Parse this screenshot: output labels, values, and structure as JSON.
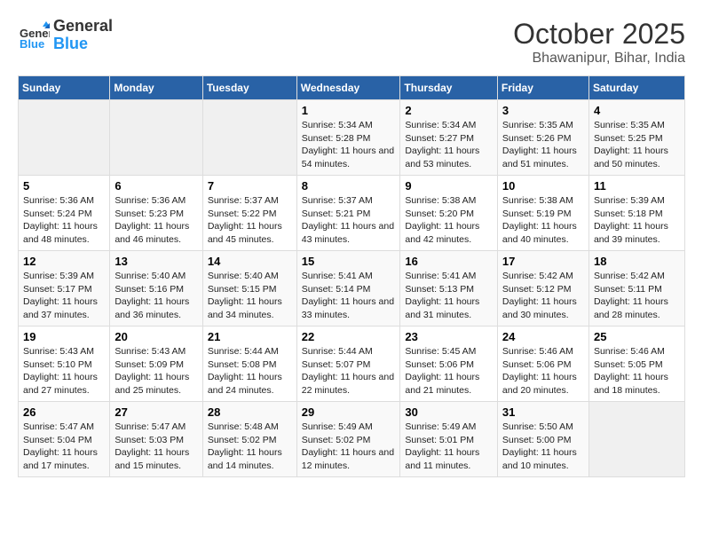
{
  "header": {
    "logo_line1": "General",
    "logo_line2": "Blue",
    "month": "October 2025",
    "location": "Bhawanipur, Bihar, India"
  },
  "weekdays": [
    "Sunday",
    "Monday",
    "Tuesday",
    "Wednesday",
    "Thursday",
    "Friday",
    "Saturday"
  ],
  "weeks": [
    [
      {
        "day": "",
        "empty": true
      },
      {
        "day": "",
        "empty": true
      },
      {
        "day": "",
        "empty": true
      },
      {
        "day": "1",
        "sunrise": "5:34 AM",
        "sunset": "5:28 PM",
        "daylight": "11 hours and 54 minutes."
      },
      {
        "day": "2",
        "sunrise": "5:34 AM",
        "sunset": "5:27 PM",
        "daylight": "11 hours and 53 minutes."
      },
      {
        "day": "3",
        "sunrise": "5:35 AM",
        "sunset": "5:26 PM",
        "daylight": "11 hours and 51 minutes."
      },
      {
        "day": "4",
        "sunrise": "5:35 AM",
        "sunset": "5:25 PM",
        "daylight": "11 hours and 50 minutes."
      }
    ],
    [
      {
        "day": "5",
        "sunrise": "5:36 AM",
        "sunset": "5:24 PM",
        "daylight": "11 hours and 48 minutes."
      },
      {
        "day": "6",
        "sunrise": "5:36 AM",
        "sunset": "5:23 PM",
        "daylight": "11 hours and 46 minutes."
      },
      {
        "day": "7",
        "sunrise": "5:37 AM",
        "sunset": "5:22 PM",
        "daylight": "11 hours and 45 minutes."
      },
      {
        "day": "8",
        "sunrise": "5:37 AM",
        "sunset": "5:21 PM",
        "daylight": "11 hours and 43 minutes."
      },
      {
        "day": "9",
        "sunrise": "5:38 AM",
        "sunset": "5:20 PM",
        "daylight": "11 hours and 42 minutes."
      },
      {
        "day": "10",
        "sunrise": "5:38 AM",
        "sunset": "5:19 PM",
        "daylight": "11 hours and 40 minutes."
      },
      {
        "day": "11",
        "sunrise": "5:39 AM",
        "sunset": "5:18 PM",
        "daylight": "11 hours and 39 minutes."
      }
    ],
    [
      {
        "day": "12",
        "sunrise": "5:39 AM",
        "sunset": "5:17 PM",
        "daylight": "11 hours and 37 minutes."
      },
      {
        "day": "13",
        "sunrise": "5:40 AM",
        "sunset": "5:16 PM",
        "daylight": "11 hours and 36 minutes."
      },
      {
        "day": "14",
        "sunrise": "5:40 AM",
        "sunset": "5:15 PM",
        "daylight": "11 hours and 34 minutes."
      },
      {
        "day": "15",
        "sunrise": "5:41 AM",
        "sunset": "5:14 PM",
        "daylight": "11 hours and 33 minutes."
      },
      {
        "day": "16",
        "sunrise": "5:41 AM",
        "sunset": "5:13 PM",
        "daylight": "11 hours and 31 minutes."
      },
      {
        "day": "17",
        "sunrise": "5:42 AM",
        "sunset": "5:12 PM",
        "daylight": "11 hours and 30 minutes."
      },
      {
        "day": "18",
        "sunrise": "5:42 AM",
        "sunset": "5:11 PM",
        "daylight": "11 hours and 28 minutes."
      }
    ],
    [
      {
        "day": "19",
        "sunrise": "5:43 AM",
        "sunset": "5:10 PM",
        "daylight": "11 hours and 27 minutes."
      },
      {
        "day": "20",
        "sunrise": "5:43 AM",
        "sunset": "5:09 PM",
        "daylight": "11 hours and 25 minutes."
      },
      {
        "day": "21",
        "sunrise": "5:44 AM",
        "sunset": "5:08 PM",
        "daylight": "11 hours and 24 minutes."
      },
      {
        "day": "22",
        "sunrise": "5:44 AM",
        "sunset": "5:07 PM",
        "daylight": "11 hours and 22 minutes."
      },
      {
        "day": "23",
        "sunrise": "5:45 AM",
        "sunset": "5:06 PM",
        "daylight": "11 hours and 21 minutes."
      },
      {
        "day": "24",
        "sunrise": "5:46 AM",
        "sunset": "5:06 PM",
        "daylight": "11 hours and 20 minutes."
      },
      {
        "day": "25",
        "sunrise": "5:46 AM",
        "sunset": "5:05 PM",
        "daylight": "11 hours and 18 minutes."
      }
    ],
    [
      {
        "day": "26",
        "sunrise": "5:47 AM",
        "sunset": "5:04 PM",
        "daylight": "11 hours and 17 minutes."
      },
      {
        "day": "27",
        "sunrise": "5:47 AM",
        "sunset": "5:03 PM",
        "daylight": "11 hours and 15 minutes."
      },
      {
        "day": "28",
        "sunrise": "5:48 AM",
        "sunset": "5:02 PM",
        "daylight": "11 hours and 14 minutes."
      },
      {
        "day": "29",
        "sunrise": "5:49 AM",
        "sunset": "5:02 PM",
        "daylight": "11 hours and 12 minutes."
      },
      {
        "day": "30",
        "sunrise": "5:49 AM",
        "sunset": "5:01 PM",
        "daylight": "11 hours and 11 minutes."
      },
      {
        "day": "31",
        "sunrise": "5:50 AM",
        "sunset": "5:00 PM",
        "daylight": "11 hours and 10 minutes."
      },
      {
        "day": "",
        "empty": true
      }
    ]
  ],
  "labels": {
    "sunrise_prefix": "Sunrise: ",
    "sunset_prefix": "Sunset: ",
    "daylight_prefix": "Daylight: "
  }
}
